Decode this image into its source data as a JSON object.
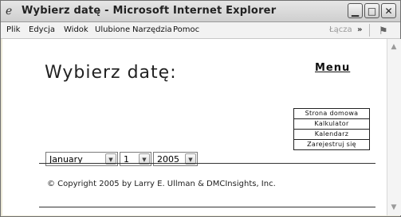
{
  "window": {
    "title": "Wybierz datę - Microsoft Internet Explorer",
    "minimize_icon": "minimize-icon",
    "maximize_icon": "maximize-icon",
    "close_icon": "close-icon"
  },
  "menubar": {
    "items": [
      "Plik",
      "Edycja",
      "Widok",
      "Ulubione",
      "Narzędzia",
      "Pomoc"
    ],
    "links_label": "Łącza",
    "chevron": "»"
  },
  "page": {
    "title": "Wybierz datę:",
    "menu_heading": "Menu",
    "nav_links": [
      "Strona domowa",
      "Kalkulator",
      "Kalendarz",
      "Zarejestruj się"
    ],
    "month": "January",
    "day": "1",
    "year": "2005",
    "copyright": "© Copyright 2005 by Larry E. Ullman & DMCInsights, Inc."
  }
}
